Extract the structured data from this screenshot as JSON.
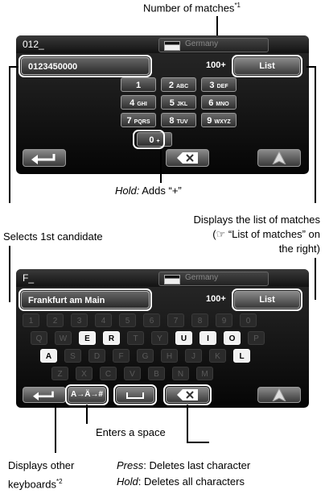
{
  "numeric_screen": {
    "typed": "012_",
    "country": "Germany",
    "candidate": "0123450000",
    "match_count": "100+",
    "list_label": "List",
    "keys": [
      {
        "main": "1",
        "sub": ""
      },
      {
        "main": "2",
        "sub": "ABC"
      },
      {
        "main": "3",
        "sub": "DEF"
      },
      {
        "main": "4",
        "sub": "GHI"
      },
      {
        "main": "5",
        "sub": "JKL"
      },
      {
        "main": "6",
        "sub": "MNO"
      },
      {
        "main": "7",
        "sub": "PQRS"
      },
      {
        "main": "8",
        "sub": "TUV"
      },
      {
        "main": "9",
        "sub": "WXYZ"
      },
      {
        "main": "0",
        "sub": "+"
      }
    ]
  },
  "alpha_screen": {
    "typed": "F_",
    "country": "Germany",
    "candidate": "Frankfurt am Main",
    "match_count": "100+",
    "list_label": "List",
    "keyboard_switch_label": "A→Ä→#",
    "number_row": [
      "1",
      "2",
      "3",
      "4",
      "5",
      "6",
      "7",
      "8",
      "9",
      "0"
    ],
    "row1": [
      "Q",
      "W",
      "E",
      "R",
      "T",
      "Y",
      "U",
      "I",
      "O",
      "P"
    ],
    "row2": [
      "A",
      "S",
      "D",
      "F",
      "G",
      "H",
      "J",
      "K",
      "L"
    ],
    "row3": [
      "Z",
      "X",
      "C",
      "V",
      "B",
      "N",
      "M"
    ]
  },
  "annotations": {
    "matches_text": "Number of matches",
    "matches_note": "*1",
    "hold_label": "Hold:",
    "hold_text": " Adds “+”",
    "selects": "Selects 1st candidate",
    "list_line1": "Displays the list of matches",
    "list_line2": "(☞ “List of matches” on",
    "list_line3": "the right)",
    "space": "Enters a space",
    "other_line1": "Displays other",
    "other_line2": "keyboards",
    "other_note": "*2",
    "press_label": "Press",
    "press_text": ": Deletes last character",
    "hold2_label": "Hold",
    "hold2_text": ": Deletes all characters"
  }
}
